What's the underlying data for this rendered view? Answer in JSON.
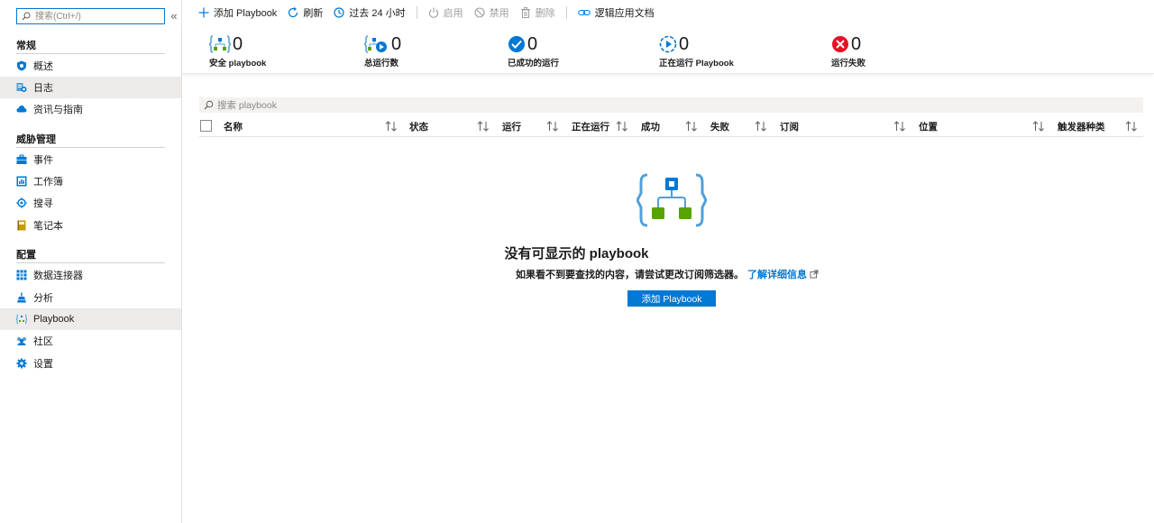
{
  "sidebar": {
    "search_placeholder": "搜索(Ctrl+/)",
    "collapse_glyph": "«",
    "sections": [
      {
        "title": "常规"
      },
      {
        "title": "威胁管理"
      },
      {
        "title": "配置"
      }
    ],
    "items": [
      {
        "label": "概述",
        "icon": "shield-icon",
        "active": false
      },
      {
        "label": "日志",
        "icon": "logs-icon",
        "active": true
      },
      {
        "label": "资讯与指南",
        "icon": "cloud-icon",
        "active": false
      },
      {
        "label": "事件",
        "icon": "briefcase-icon",
        "active": false
      },
      {
        "label": "工作簿",
        "icon": "workbook-icon",
        "active": false
      },
      {
        "label": "搜寻",
        "icon": "target-icon",
        "active": false
      },
      {
        "label": "笔记本",
        "icon": "notebook-icon",
        "active": false
      },
      {
        "label": "数据连接器",
        "icon": "grid-icon",
        "active": false
      },
      {
        "label": "分析",
        "icon": "flask-icon",
        "active": false
      },
      {
        "label": "Playbook",
        "icon": "playbook-icon",
        "active": true
      },
      {
        "label": "社区",
        "icon": "community-icon",
        "active": false
      },
      {
        "label": "设置",
        "icon": "gear-icon",
        "active": false
      }
    ]
  },
  "toolbar": {
    "add": "添加 Playbook",
    "refresh": "刷新",
    "timerange": "过去 24 小时",
    "enable": "启用",
    "disable": "禁用",
    "delete": "删除",
    "docs": "逻辑应用文档"
  },
  "stats": [
    {
      "value": "0",
      "label": "安全 playbook",
      "icon": "playbook-braces-icon"
    },
    {
      "value": "0",
      "label": "总运行数",
      "icon": "total-runs-icon"
    },
    {
      "value": "0",
      "label": "已成功的运行",
      "icon": "success-check-icon"
    },
    {
      "value": "0",
      "label": "正在运行 Playbook",
      "icon": "running-icon"
    },
    {
      "value": "0",
      "label": "运行失败",
      "icon": "failed-x-icon"
    }
  ],
  "grid": {
    "search_placeholder": "搜索 playbook",
    "columns": [
      "名称",
      "状态",
      "运行",
      "正在运行",
      "成功",
      "失败",
      "订阅",
      "位置",
      "触发器种类"
    ]
  },
  "empty": {
    "title": "没有可显示的 playbook",
    "message": "如果看不到要查找的内容，请尝试更改订阅筛选器。",
    "link": "了解详细信息",
    "button": "添加 Playbook"
  },
  "colors": {
    "accent": "#0078d4",
    "success": "#0078d4",
    "failed": "#e81123",
    "green": "#57a300"
  }
}
